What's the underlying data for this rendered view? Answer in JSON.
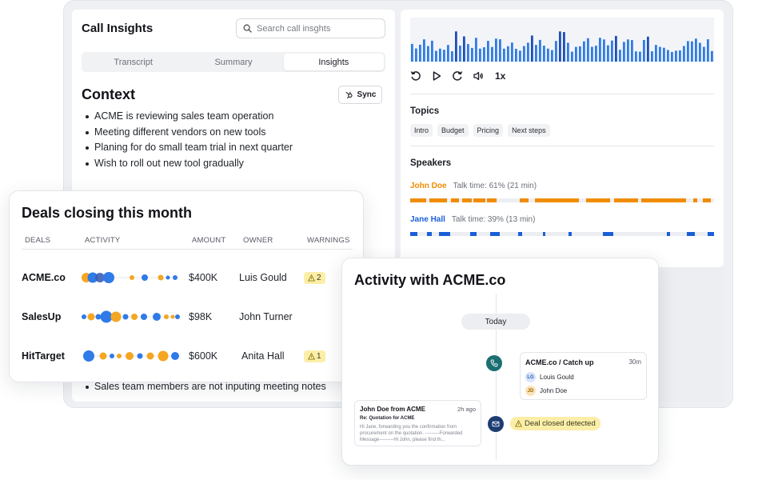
{
  "call_insights": {
    "title": "Call Insights",
    "search_placeholder": "Search call insghts",
    "tabs": [
      {
        "label": "Transcript",
        "active": false
      },
      {
        "label": "Summary",
        "active": false
      },
      {
        "label": "Insights",
        "active": true
      }
    ],
    "context_title": "Context",
    "sync_label": "Sync",
    "context_items": [
      "ACME is reviewing sales team operation",
      "Meeting different vendors on new tools",
      "Planing for do small team trial in next quarter",
      "Wish to roll out new tool gradually"
    ],
    "bottom_note": "Sales team members are not inputing meeting notes"
  },
  "player": {
    "speed": "1x",
    "icons": [
      "replay-icon",
      "play-icon",
      "forward-icon",
      "volume-icon"
    ],
    "waveform_color": "#2f7be8",
    "waveform_color_dark": "#1d4fb8"
  },
  "topics": {
    "label": "Topics",
    "items": [
      "Intro",
      "Budget",
      "Pricing",
      "Next steps"
    ]
  },
  "speakers": {
    "label": "Speakers",
    "items": [
      {
        "name": "John Doe",
        "talk_time": "Talk time: 61% (21 min)",
        "color": "#f08c00"
      },
      {
        "name": "Jane Hall",
        "talk_time": "Talk time: 39% (13 min)",
        "color": "#1a5fd8"
      }
    ]
  },
  "deals": {
    "title": "Deals closing this month",
    "headers": {
      "deals": "DEALS",
      "activity": "ACTIVITY",
      "amount": "AMOUNT",
      "owner": "OWNER",
      "warnings": "WARNINGS"
    },
    "rows": [
      {
        "name": "ACME.co",
        "amount": "$400K",
        "owner": "Luis Gould",
        "warnings": "2"
      },
      {
        "name": "SalesUp",
        "amount": "$98K",
        "owner": "John Turner",
        "warnings": ""
      },
      {
        "name": "HitTarget",
        "amount": "$600K",
        "owner": "Anita Hall",
        "warnings": "1"
      }
    ],
    "colors": {
      "blue": "#2f7be8",
      "orange": "#f5a623",
      "warning_bg": "#fbeea8"
    }
  },
  "activity": {
    "title": "Activity with ACME.co",
    "today_label": "Today",
    "meeting": {
      "title": "ACME.co / Catch up",
      "duration": "30m",
      "attendees": [
        {
          "initials": "LG",
          "name": "Louis Gould"
        },
        {
          "initials": "JD",
          "name": "John Doe"
        }
      ]
    },
    "deal_closed": "Deal closed detected",
    "email": {
      "from": "John Doe from ACME",
      "time": "2h ago",
      "subject": "Re: Quotation for ACME",
      "body": "Hi Jane, forwarding you the confirmation from procurement on the quotation. ---------Forwarded Message---------Hi John, please find th..."
    }
  }
}
